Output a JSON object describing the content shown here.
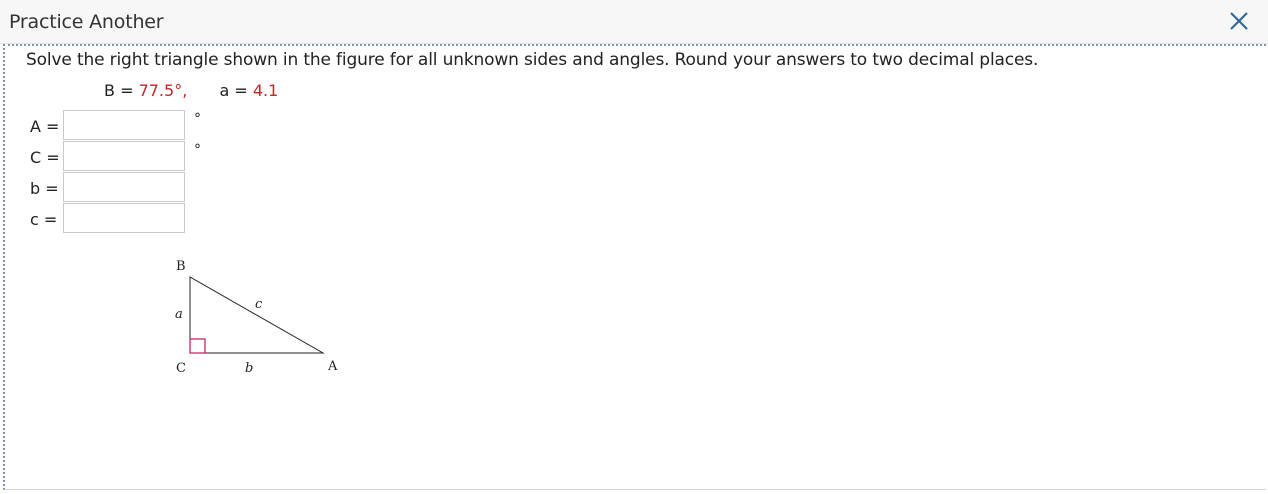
{
  "header": {
    "title": "Practice Another"
  },
  "question": {
    "text": "Solve the right triangle shown in the figure for all unknown sides and angles. Round your answers to two decimal places.",
    "givens": [
      {
        "label": "B =",
        "value": "77.5°,"
      },
      {
        "label": "a =",
        "value": "4.1"
      }
    ]
  },
  "answers": [
    {
      "label": "A =",
      "value": "",
      "unit": "°"
    },
    {
      "label": "C =",
      "value": "",
      "unit": "°"
    },
    {
      "label": "b =",
      "value": "",
      "unit": ""
    },
    {
      "label": "c =",
      "value": "",
      "unit": ""
    }
  ],
  "figure": {
    "vertices": {
      "B": "B",
      "C": "C",
      "A": "A"
    },
    "sides": {
      "a": "a",
      "b": "b",
      "c": "c"
    }
  },
  "colors": {
    "given_value": "#c4242a",
    "right_angle_marker": "#c2185b",
    "panel_border": "#7c95b5"
  }
}
